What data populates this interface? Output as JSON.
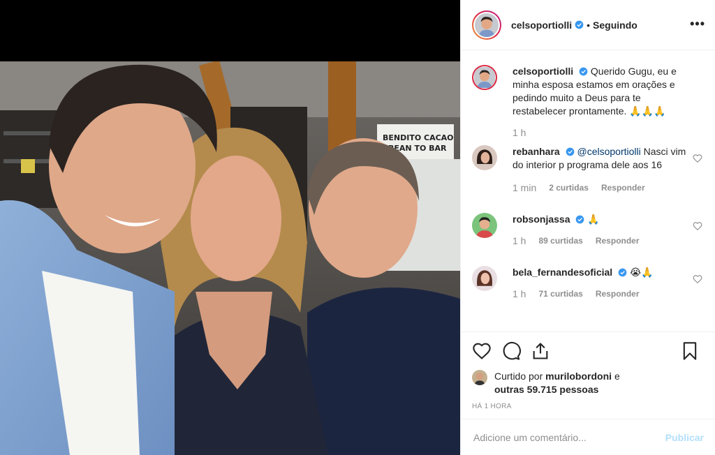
{
  "header": {
    "username": "celsoportiolli",
    "separator": "•",
    "follow_status": "Seguindo",
    "more_label": "•••"
  },
  "caption": {
    "username": "celsoportiolli",
    "text": "Querido Gugu, eu e minha esposa estamos em orações e pedindo muito a Deus para te restabelecer prontamente. 🙏🙏🙏",
    "time": "1 h"
  },
  "comments": [
    {
      "username": "rebanhara",
      "mention": "@celsoportiolli",
      "text": "Nasci vim do interior p programa dele aos 16",
      "time": "1 min",
      "likes": "2 curtidas",
      "reply": "Responder"
    },
    {
      "username": "robsonjassa",
      "mention": "",
      "text": "🙏",
      "time": "1 h",
      "likes": "89 curtidas",
      "reply": "Responder"
    },
    {
      "username": "bela_fernandesoficial",
      "mention": "",
      "text": "😭🙏",
      "time": "1 h",
      "likes": "71 curtidas",
      "reply": "Responder"
    }
  ],
  "likes": {
    "prefix": "Curtido por",
    "user": "murilobordoni",
    "conj": "e",
    "others": "outras 59.715 pessoas"
  },
  "timestamp": "HÁ 1 HORA",
  "add_comment": {
    "placeholder": "Adicione um comentário...",
    "publish": "Publicar"
  },
  "photo": {
    "sign_line1": "BENDITO CACAO",
    "sign_line2": "BEAN TO BAR"
  },
  "colors": {
    "verified": "#3897f0",
    "link": "#00376b",
    "muted": "#8e8e8e",
    "publish_disabled": "#b2dffc"
  }
}
